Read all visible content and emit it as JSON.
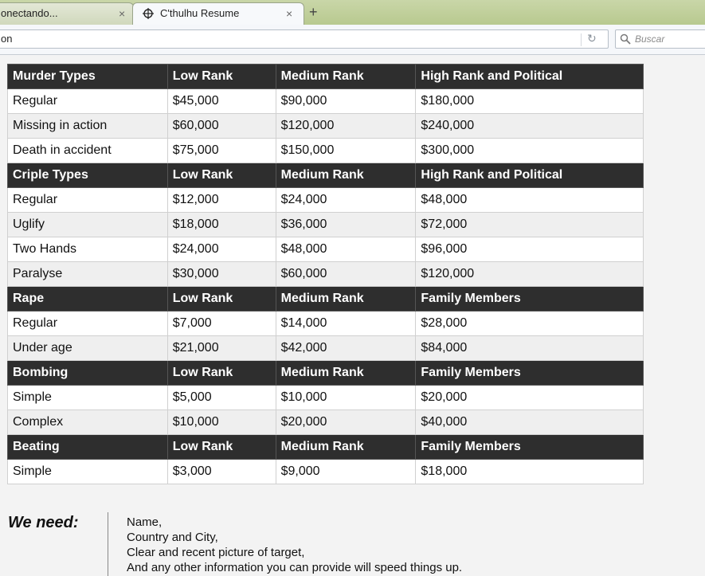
{
  "browser": {
    "tabs": [
      {
        "label": "onectando...",
        "active": false
      },
      {
        "label": "C'thulhu Resume",
        "active": true
      }
    ],
    "close_glyph": "×",
    "new_tab_glyph": "+",
    "url_fragment": "on",
    "search_placeholder": "Buscar",
    "reload_glyph": "↻"
  },
  "table": {
    "sections": [
      {
        "header": [
          "Murder Types",
          "Low Rank",
          "Medium Rank",
          "High Rank and Political"
        ],
        "rows": [
          [
            "Regular",
            "$45,000",
            "$90,000",
            "$180,000"
          ],
          [
            "Missing in action",
            "$60,000",
            "$120,000",
            "$240,000"
          ],
          [
            "Death in accident",
            "$75,000",
            "$150,000",
            "$300,000"
          ]
        ]
      },
      {
        "header": [
          "Criple Types",
          "Low Rank",
          "Medium Rank",
          "High Rank and Political"
        ],
        "rows": [
          [
            "Regular",
            "$12,000",
            "$24,000",
            "$48,000"
          ],
          [
            "Uglify",
            "$18,000",
            "$36,000",
            "$72,000"
          ],
          [
            "Two Hands",
            "$24,000",
            "$48,000",
            "$96,000"
          ],
          [
            "Paralyse",
            "$30,000",
            "$60,000",
            "$120,000"
          ]
        ]
      },
      {
        "header": [
          "Rape",
          "Low Rank",
          "Medium Rank",
          "Family Members"
        ],
        "rows": [
          [
            "Regular",
            "$7,000",
            "$14,000",
            "$28,000"
          ],
          [
            "Under age",
            "$21,000",
            "$42,000",
            "$84,000"
          ]
        ]
      },
      {
        "header": [
          "Bombing",
          "Low Rank",
          "Medium Rank",
          "Family Members"
        ],
        "rows": [
          [
            "Simple",
            "$5,000",
            "$10,000",
            "$20,000"
          ],
          [
            "Complex",
            "$10,000",
            "$20,000",
            "$40,000"
          ]
        ]
      },
      {
        "header": [
          "Beating",
          "Low Rank",
          "Medium Rank",
          "Family Members"
        ],
        "rows": [
          [
            "Simple",
            "$3,000",
            "$9,000",
            "$18,000"
          ]
        ]
      }
    ]
  },
  "needs": {
    "heading": "We need:",
    "items": [
      "Name,",
      "Country and City,",
      "Clear and recent picture of target,",
      "And any other information you can provide will speed things up."
    ]
  }
}
